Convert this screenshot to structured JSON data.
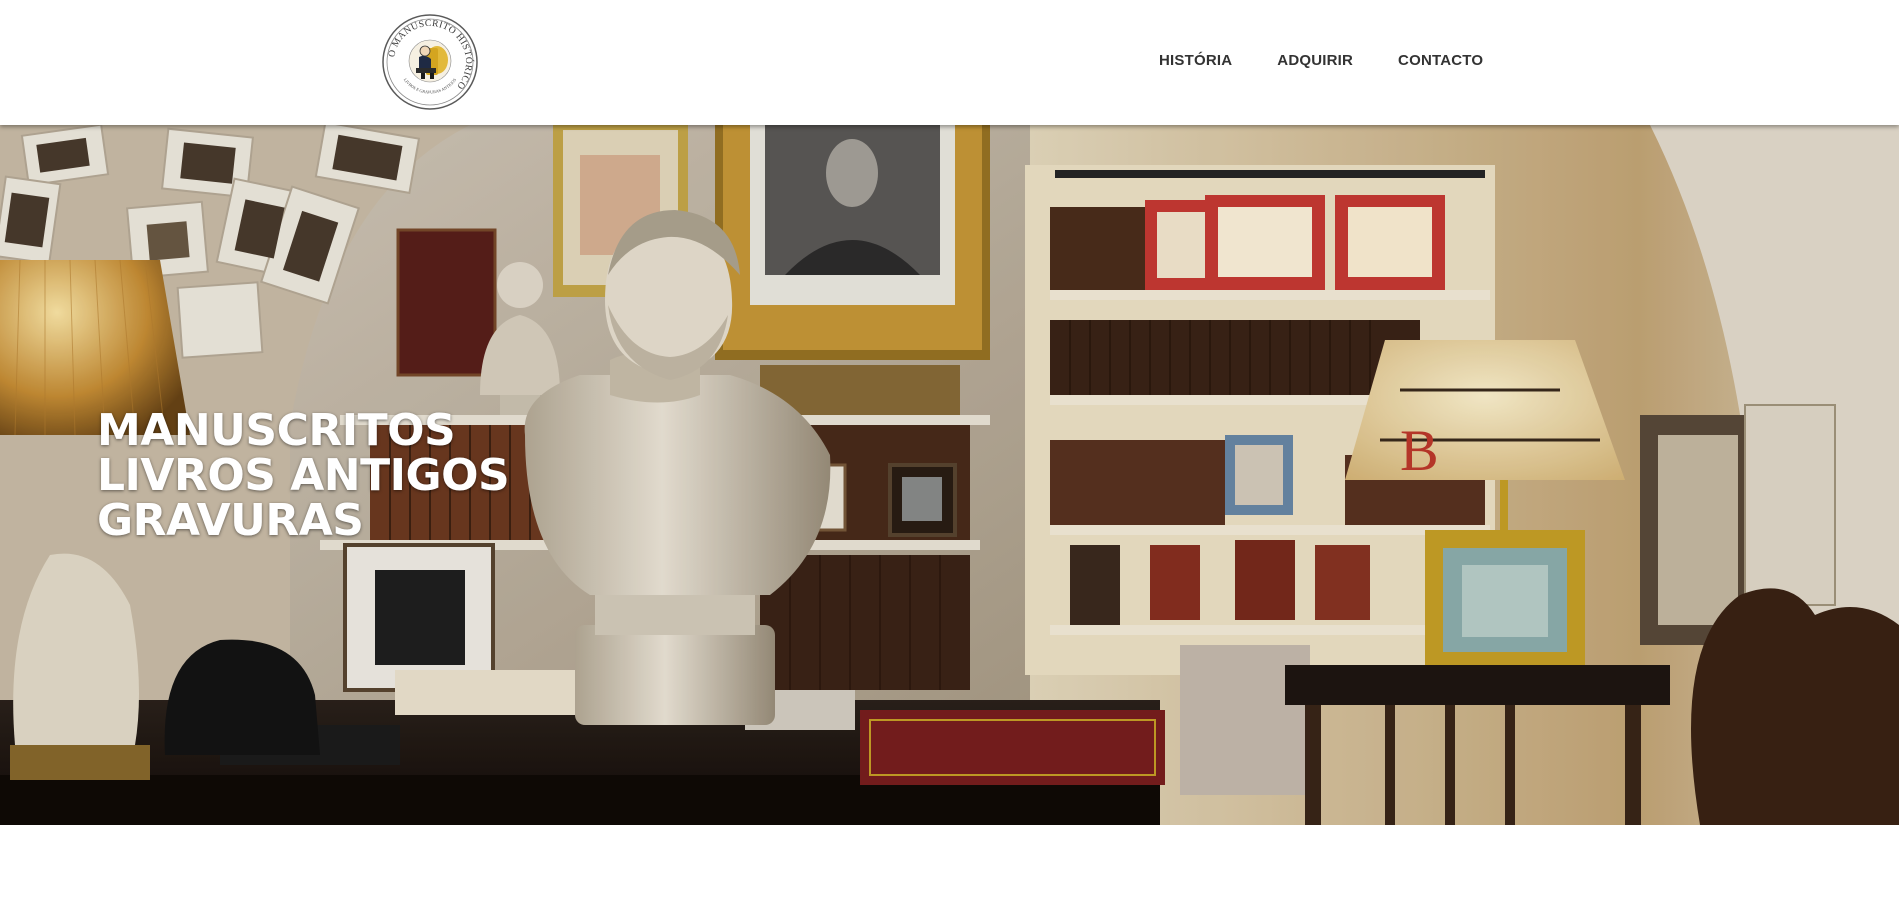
{
  "brand": {
    "logo_ring_text": "O MANUSCRITO HISTÓRICO",
    "logo_sub_text": "LIVROS E GRAVURAS ANTIGOS"
  },
  "nav": {
    "items": [
      {
        "label": "HISTÓRIA"
      },
      {
        "label": "ADQUIRIR"
      },
      {
        "label": "CONTACTO"
      }
    ]
  },
  "hero": {
    "lines": [
      "MANUSCRITOS",
      "LIVROS ANTIGOS",
      "GRAVURAS"
    ],
    "lampshade_text": "B"
  },
  "colors": {
    "nav_text": "#333333",
    "hero_text": "#ffffff",
    "logo_ring": "#4a4a4a",
    "logo_accent": "#c9a227"
  }
}
